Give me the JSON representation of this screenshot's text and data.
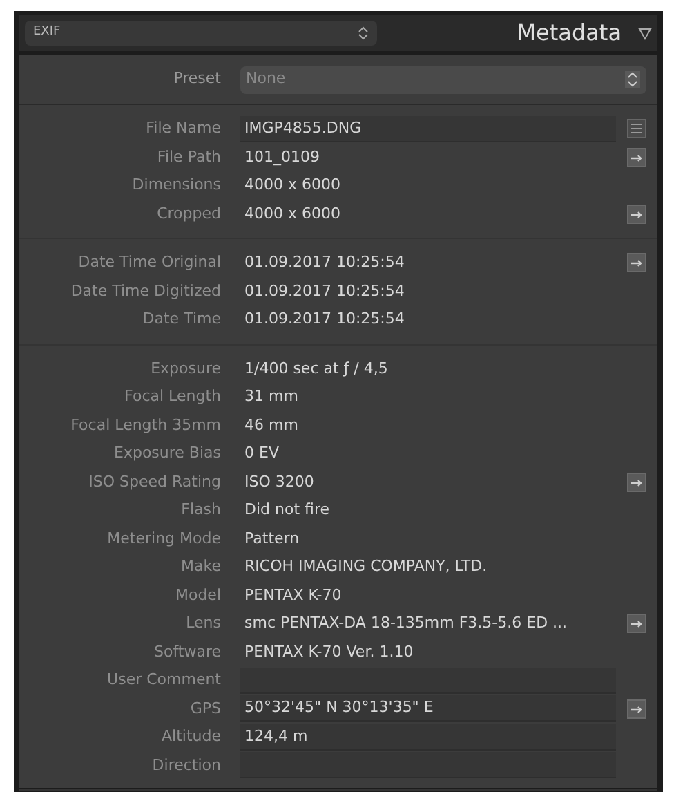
{
  "header": {
    "preset_select": "EXIF",
    "title": "Metadata"
  },
  "preset": {
    "label": "Preset",
    "value": "None"
  },
  "groups": [
    {
      "rows": [
        {
          "label": "File Name",
          "value": "IMGP4855.DNG",
          "editable": true,
          "action": {
            "kind": "list"
          }
        },
        {
          "label": "File Path",
          "value": "101_0109",
          "editable": false,
          "action": {
            "kind": "arrow"
          }
        },
        {
          "label": "Dimensions",
          "value": "4000 x 6000",
          "editable": false
        },
        {
          "label": "Cropped",
          "value": "4000 x 6000",
          "editable": false,
          "action": {
            "kind": "arrow"
          }
        }
      ]
    },
    {
      "rows": [
        {
          "label": "Date Time Original",
          "value": "01.09.2017 10:25:54",
          "editable": false,
          "action": {
            "kind": "arrow"
          }
        },
        {
          "label": "Date Time Digitized",
          "value": "01.09.2017 10:25:54",
          "editable": false
        },
        {
          "label": "Date Time",
          "value": "01.09.2017 10:25:54",
          "editable": false
        }
      ]
    },
    {
      "rows": [
        {
          "label": "Exposure",
          "value": "1/400 sec at ƒ / 4,5",
          "editable": false
        },
        {
          "label": "Focal Length",
          "value": "31 mm",
          "editable": false
        },
        {
          "label": "Focal Length 35mm",
          "value": "46 mm",
          "editable": false
        },
        {
          "label": "Exposure Bias",
          "value": "0 EV",
          "editable": false
        },
        {
          "label": "ISO Speed Rating",
          "value": "ISO 3200",
          "editable": false,
          "action": {
            "kind": "arrow"
          }
        },
        {
          "label": "Flash",
          "value": "Did not fire",
          "editable": false
        },
        {
          "label": "Metering Mode",
          "value": "Pattern",
          "editable": false
        },
        {
          "label": "Make",
          "value": "RICOH IMAGING COMPANY, LTD.",
          "editable": false
        },
        {
          "label": "Model",
          "value": "PENTAX K-70",
          "editable": false
        },
        {
          "label": "Lens",
          "value": "smc PENTAX-DA 18-135mm F3.5-5.6 ED ...",
          "editable": false,
          "action": {
            "kind": "arrow"
          }
        },
        {
          "label": "Software",
          "value": "PENTAX K-70 Ver. 1.10",
          "editable": false
        },
        {
          "label": "User Comment",
          "editable": true
        },
        {
          "label": "GPS",
          "value": "50°32'45\" N 30°13'35\" E",
          "editable": true,
          "action": {
            "kind": "arrow"
          }
        },
        {
          "label": "Altitude",
          "value": "124,4 m",
          "editable": true
        },
        {
          "label": "Direction",
          "editable": true
        }
      ]
    }
  ]
}
